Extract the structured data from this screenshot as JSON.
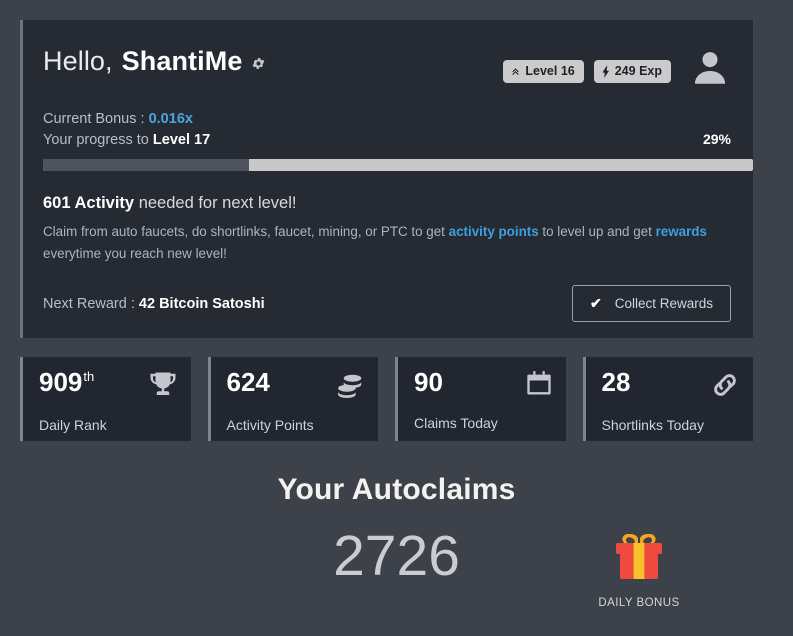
{
  "header": {
    "greeting_prefix": "Hello,",
    "username": "ShantiMe",
    "gear_icon": "gear-icon",
    "avatar_icon": "user-avatar-icon",
    "level_badge": {
      "icon": "chevron-up-icon",
      "label": "Level 16"
    },
    "exp_badge": {
      "icon": "lightning-bolt-icon",
      "label": "249 Exp"
    }
  },
  "bonus": {
    "label": "Current Bonus :",
    "value": "0.016x"
  },
  "progress": {
    "label_prefix": "Your progress to",
    "next_level": "Level 17",
    "percent_text": "29%",
    "percent": 29,
    "fill_color": "#4e535e",
    "track_color": "#c8c8c8"
  },
  "activity": {
    "amount": "601 Activity",
    "headline_rest": " needed for next level!",
    "description_part1": "Claim from auto faucets, do shortlinks, faucet, mining, or PTC to get ",
    "link_activity_points": "activity points",
    "description_part2": " to level up and get ",
    "link_rewards": "rewards",
    "description_part3": " everytime you reach new level!",
    "link_color": "#3e9fe0"
  },
  "reward": {
    "label": "Next Reward :",
    "value": "42 Bitcoin Satoshi",
    "collect_button": "Collect Rewards",
    "collect_icon": "check-icon"
  },
  "stats": [
    {
      "value": "909",
      "suffix": "th",
      "label": "Daily Rank",
      "icon": "trophy-icon"
    },
    {
      "value": "624",
      "suffix": "",
      "label": "Activity Points",
      "icon": "coins-icon"
    },
    {
      "value": "90",
      "suffix": "",
      "label": "Claims Today",
      "icon": "calendar-check-icon"
    },
    {
      "value": "28",
      "suffix": "",
      "label": "Shortlinks Today",
      "icon": "link-icon"
    }
  ],
  "autoclaims": {
    "title": "Your Autoclaims",
    "value": "2726"
  },
  "daily_bonus": {
    "icon": "gift-box-icon",
    "label": "DAILY BONUS"
  }
}
